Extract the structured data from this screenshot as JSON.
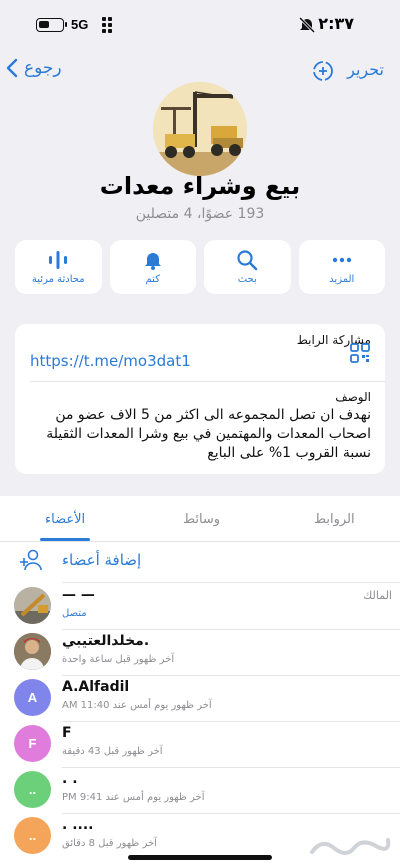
{
  "status": {
    "network": "5G",
    "time": "٢:٣٧"
  },
  "nav": {
    "back_label": "رجوع",
    "edit_label": "تحرير"
  },
  "group": {
    "title": "بيع وشراء معدات",
    "subtitle": "193 عضوًا، 4 متصلين"
  },
  "actions": [
    {
      "label": "المزيد",
      "icon": "more-icon"
    },
    {
      "label": "بحث",
      "icon": "search-icon"
    },
    {
      "label": "كتم",
      "icon": "bell-icon"
    },
    {
      "label": "محادثة مرئية",
      "icon": "voice-chat-icon"
    }
  ],
  "info": {
    "link_label": "مشاركة الرابط",
    "link_value": "https://t.me/mo3dat1",
    "description_label": "الوصف",
    "description": "نهدف ان تصل المجموعه  الى اكثر من 5 الاف عضو من اصحاب المعدات والمهتمين في بيع وشرا المعدات الثقيلة نسبة القروب 1% على البايع"
  },
  "tabs": {
    "members": "الأعضاء",
    "media": "وسائط",
    "links": "الروابط",
    "active": "members"
  },
  "add_members_label": "إضافة أعضاء",
  "members": [
    {
      "name": "—‏ —",
      "status": "متصل",
      "online": true,
      "role": "المالك",
      "avatar_letter": "",
      "avatar_color": "#9aa0a6"
    },
    {
      "name": "مخلدالعتيبي.",
      "status": "آخر ظهور قبل ساعة واحدة",
      "online": false,
      "role": "",
      "avatar_letter": "",
      "avatar_color": "#6b5a4c"
    },
    {
      "name": "A.Alfadil",
      "status": "آخر ظهور يوم أمس عند 11:40 AM",
      "online": false,
      "role": "",
      "avatar_letter": "A",
      "avatar_color": "#7f85ea"
    },
    {
      "name": "F",
      "status": "آخر ظهور قبل 43 دقيقة",
      "online": false,
      "role": "",
      "avatar_letter": "F",
      "avatar_color": "#e07ddc"
    },
    {
      "name": ". .",
      "status": "آخر ظهور يوم أمس عند 9:41 PM",
      "online": false,
      "role": "",
      "avatar_letter": "..",
      "avatar_color": "#6ccf7a"
    },
    {
      "name": ". ....",
      "status": "آخر ظهور قبل 8 دقائق",
      "online": false,
      "role": "",
      "avatar_letter": "..",
      "avatar_color": "#f5a55a"
    }
  ],
  "colors": {
    "accent": "#2a7ad8",
    "background": "#efeff4"
  }
}
